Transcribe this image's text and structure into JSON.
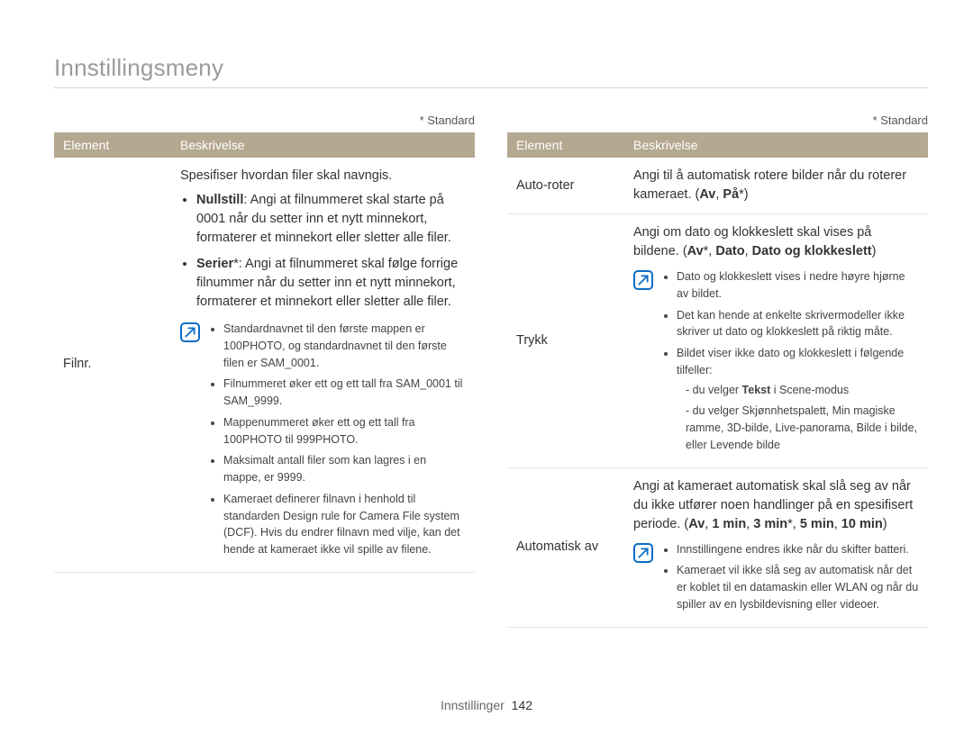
{
  "page_title": "Innstillingsmeny",
  "standard_label": "* Standard",
  "headers": {
    "element": "Element",
    "beskrivelse": "Beskrivelse"
  },
  "left": {
    "row1": {
      "element": "Filnr.",
      "intro": "Spesifiser hvordan filer skal navngis.",
      "bul1_label": "Nullstill",
      "bul1_text": ": Angi at filnummeret skal starte på 0001 når du setter inn et nytt minnekort, formaterer et minnekort eller sletter alle filer.",
      "bul2_label": "Serier",
      "bul2_text": "*: Angi at filnummeret skal følge forrige filnummer når du setter inn et nytt minnekort, formaterer et minnekort eller sletter alle filer.",
      "note1": "Standardnavnet til den første mappen er 100PHOTO, og standardnavnet til den første filen er SAM_0001.",
      "note2": "Filnummeret øker ett og ett tall fra SAM_0001 til SAM_9999.",
      "note3": "Mappenummeret øker ett og ett tall fra 100PHOTO til 999PHOTO.",
      "note4": "Maksimalt antall filer som kan lagres i en mappe, er 9999.",
      "note5": "Kameraet definerer filnavn i henhold til standarden Design rule for Camera File system (DCF). Hvis du endrer filnavn med vilje, kan det hende at kameraet ikke vil spille av filene."
    }
  },
  "right": {
    "row1": {
      "element": "Auto-roter",
      "text_a": "Angi til å automatisk rotere bilder når du roterer kameraet. (",
      "opt1": "Av",
      "sep": ", ",
      "opt2": "På",
      "suffix": "*)"
    },
    "row2": {
      "element": "Trykk",
      "text_a": "Angi om dato og klokkeslett skal vises på bildene. (",
      "opt1": "Av",
      "suffix1": "*, ",
      "opt2": "Dato",
      "sep": ", ",
      "opt3": "Dato og klokkeslett",
      "close": ")",
      "note1": "Dato og klokkeslett vises i nedre høyre hjørne av bildet.",
      "note2": "Det kan hende at enkelte skrivermodeller ikke skriver ut dato og klokkeslett på riktig måte.",
      "note3": "Bildet viser ikke dato og klokkeslett i følgende tilfeller:",
      "note3a_pre": "du velger ",
      "note3a_bold": "Tekst",
      "note3a_post": " i Scene-modus",
      "note3b": "du velger Skjønnhetspalett, Min magiske ramme, 3D-bilde, Live-panorama, Bilde i bilde, eller Levende bilde"
    },
    "row3": {
      "element": "Automatisk av",
      "text_a": "Angi at kameraet automatisk skal slå seg av når du ikke utfører noen handlinger på en spesifisert periode. (",
      "opt1": "Av",
      "sep": ", ",
      "opt2": "1 min",
      "opt3": "3 min",
      "suffix3": "*, ",
      "opt4": "5 min",
      "opt5": "10 min",
      "close": ")",
      "note1": "Innstillingene endres ikke når du skifter batteri.",
      "note2": "Kameraet vil ikke slå seg av automatisk når det er koblet til en datamaskin eller WLAN og når du spiller av en lysbildevisning eller videoer."
    }
  },
  "footer": {
    "section": "Innstillinger",
    "page": "142"
  }
}
